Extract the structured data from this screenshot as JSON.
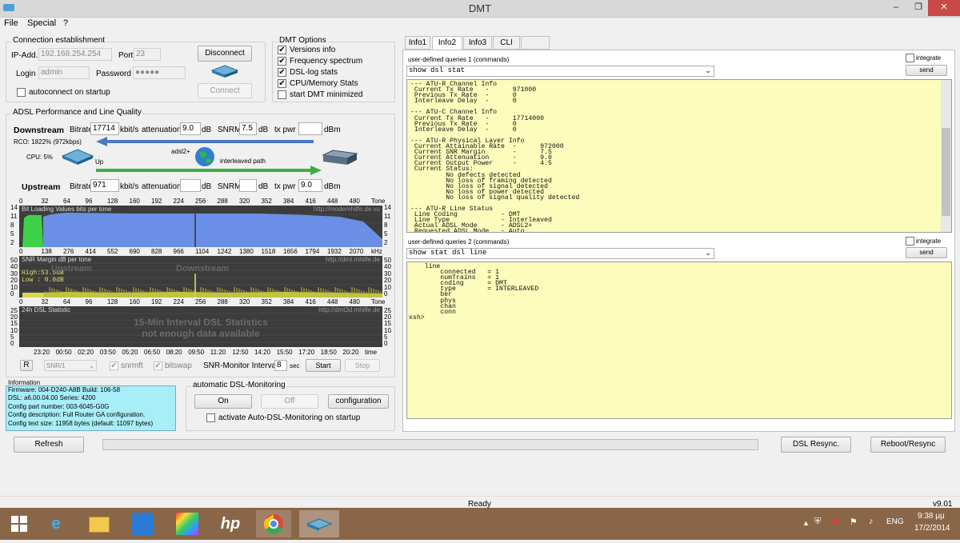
{
  "window": {
    "title": "DMT",
    "minimize": "‒",
    "maximize": "❐",
    "close": "✕"
  },
  "menu": [
    "File",
    "Special",
    "?"
  ],
  "conn": {
    "group": "Connection establishment",
    "ip_label": "IP-Add.",
    "ip": "192.168.254.254",
    "port_label": "Port",
    "port": "23",
    "login_label": "Login",
    "login": "admin",
    "pw_label": "Password",
    "pw": "●●●●●",
    "disconnect": "Disconnect",
    "connect": "Connect",
    "autoconnect": "autoconnect on startup"
  },
  "dmtopt": {
    "group": "DMT Options",
    "items": [
      {
        "label": "Versions info",
        "checked": "✔"
      },
      {
        "label": "Frequency spectrum",
        "checked": "✔"
      },
      {
        "label": "DSL-log stats",
        "checked": "✔"
      },
      {
        "label": "CPU/Memory Stats",
        "checked": "✔"
      },
      {
        "label": "start DMT minimized",
        "checked": ""
      }
    ]
  },
  "adsl": {
    "group": "ADSL Performance and Line Quality",
    "down_label": "Downstream",
    "bitrate_label": "Bitrate",
    "down_bitrate": "17714",
    "kbits": "kbit/s",
    "att_label": "attenuation",
    "down_att": "9.0",
    "db": "dB",
    "snrm_label": "SNRM",
    "down_snrm": "7.5",
    "txpwr_label": "tx pwr",
    "down_txpwr": "",
    "dbm": "dBm",
    "rco": "RCO: 1822% (972kbps)",
    "cpu": "CPU: 5%",
    "up_arrow": "Up",
    "mode": "adsl2+",
    "path": "interleaved path",
    "up_label": "Upstream",
    "up_bitrate": "971",
    "up_att": "",
    "up_snrm": "",
    "up_txpwr": "9.0"
  },
  "bitload": {
    "axis_top": [
      "0",
      "32",
      "64",
      "96",
      "128",
      "160",
      "192",
      "224",
      "256",
      "288",
      "320",
      "352",
      "384",
      "416",
      "448",
      "480",
      "Tone"
    ],
    "axis_bottom": [
      "0",
      "138",
      "276",
      "414",
      "552",
      "690",
      "828",
      "966",
      "1104",
      "1242",
      "1380",
      "1518",
      "1656",
      "1794",
      "1932",
      "2070",
      "kHz"
    ],
    "y": [
      "14",
      "11",
      "8",
      "5",
      "2"
    ],
    "title": "Bit Loading Values  bits per tone",
    "url": "http://modemhilfe.de.vu"
  },
  "snr": {
    "title": "SNR Margin  dB per tone",
    "url": "http://dmt.mhilfe.de",
    "y": [
      "50",
      "40",
      "30",
      "20",
      "10",
      "0"
    ],
    "high": "High:53.5dB",
    "low": "Low : 0.0dB",
    "watermark": "Downstream",
    "watermark2": "Upstream"
  },
  "stat24": {
    "title": "24h DSL Statistic",
    "url": "http://dmt3d.mhilfe.de",
    "y": [
      "25",
      "20",
      "15",
      "10",
      "5",
      "0"
    ],
    "msg1": "15-Min Interval DSL Statistics",
    "msg2": "not enough data available",
    "times": [
      "23:20",
      "00:50",
      "02:20",
      "03:50",
      "05:20",
      "06:50",
      "08:20",
      "09:50",
      "11:20",
      "12:50",
      "14:20",
      "15:50",
      "17:20",
      "18:50",
      "20:20",
      "time"
    ]
  },
  "controls": {
    "r": "R",
    "snrsel": "SNR/1",
    "snrmft": "snrmft",
    "bitswap": "bitswap",
    "interval_label": "SNR-Monitor Interval:",
    "interval": "8",
    "sec": "sec",
    "start": "Start",
    "stop": "Stop"
  },
  "info": {
    "title": "Information",
    "lines": [
      "Firmware: 004-D240-A8B   Build: 106-58",
      "DSL: a6.00.04.00  Series: 4200",
      "Config part number: 003-6045-G0G",
      "Config description: Full Router GA configuration.",
      "Config text size: 11958 bytes  (default: 11097 bytes)"
    ]
  },
  "auto": {
    "group": "automatic DSL-Monitoring",
    "on": "On",
    "off": "Off",
    "config": "configuration",
    "activate": "activate Auto-DSL-Monitoring on startup"
  },
  "tabs": [
    "Info1",
    "Info2",
    "Info3",
    "CLI",
    ""
  ],
  "q1": {
    "label": "user-defined queries 1 (commands)",
    "cmd": "show dsl stat",
    "integrate": "integrate",
    "send": "send"
  },
  "q2": {
    "label": "user-defined queries 2 (commands)",
    "cmd": "show stat dsl line",
    "integrate": "integrate",
    "send": "send"
  },
  "term1": "--- ATU-R Channel Info\n Current Tx Rate   -      971000\n Previous Tx Rate  -      0\n Interleave Delay  -      0\n\n--- ATU-C Channel Info\n Current Tx Rate   -      17714000\n Previous Tx Rate  -      0\n Interleave Delay  -      0\n\n--- ATU-R Physical Layer Info\n Current Attainable Rate  -      972000\n Current SNR Margin       -      7.5\n Current Attenuation      -      9.0\n Current Output Power     -      4.5\n Current Status:\n         No defects detected\n         No loss of framing detected\n         No loss of signal detected\n         No loss of power detected\n         No loss of signal quality detected\n\n--- ATU-R Line Status\n Line Coding           - DMT\n Line Type             - Interleaved\n Actual ADSL Mode      - ADSL2+\n Requested ADSL Mode   - Auto",
  "term2": "    line\n        connected   = 1\n        numTrains   = 1\n        coding      = DMT\n        type        = INTERLEAVED\n        ber\n        phys\n        chan\n        conn\nxsh>",
  "bottom": {
    "refresh": "Refresh",
    "resync": "DSL Resync.",
    "reboot": "Reboot/Resync",
    "status": "Ready",
    "version": "v9.01"
  },
  "taskbar": {
    "lang": "ENG",
    "time": "9:38 μμ",
    "date": "17/2/2014"
  }
}
